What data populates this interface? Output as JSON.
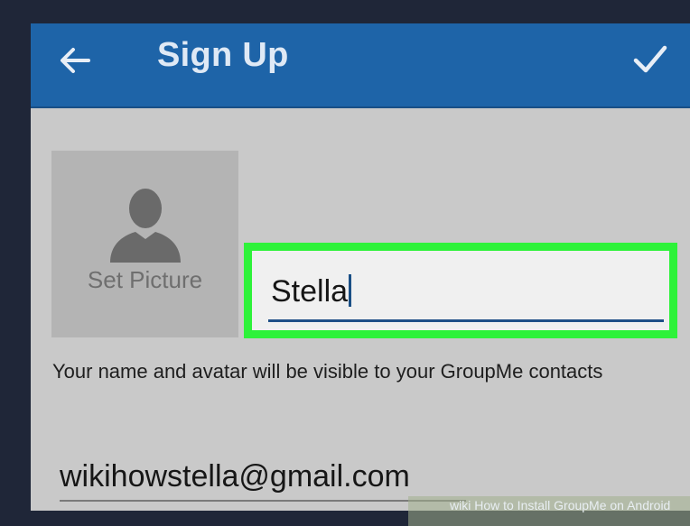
{
  "appbar": {
    "title": "Sign Up",
    "back_icon": "arrow-left-icon",
    "confirm_icon": "checkmark-icon",
    "color": "#1e64a8"
  },
  "profile": {
    "set_picture_label": "Set Picture",
    "avatar_icon": "person-silhouette-icon"
  },
  "name_field": {
    "value": "Stella",
    "highlight_color": "#2ef23a"
  },
  "hint_text": "Your name and avatar will be visible to your GroupMe contacts",
  "email_field": {
    "value": "wikihowstella@gmail.com"
  },
  "watermark": {
    "text": "wiki How to Install GroupMe on Android"
  }
}
